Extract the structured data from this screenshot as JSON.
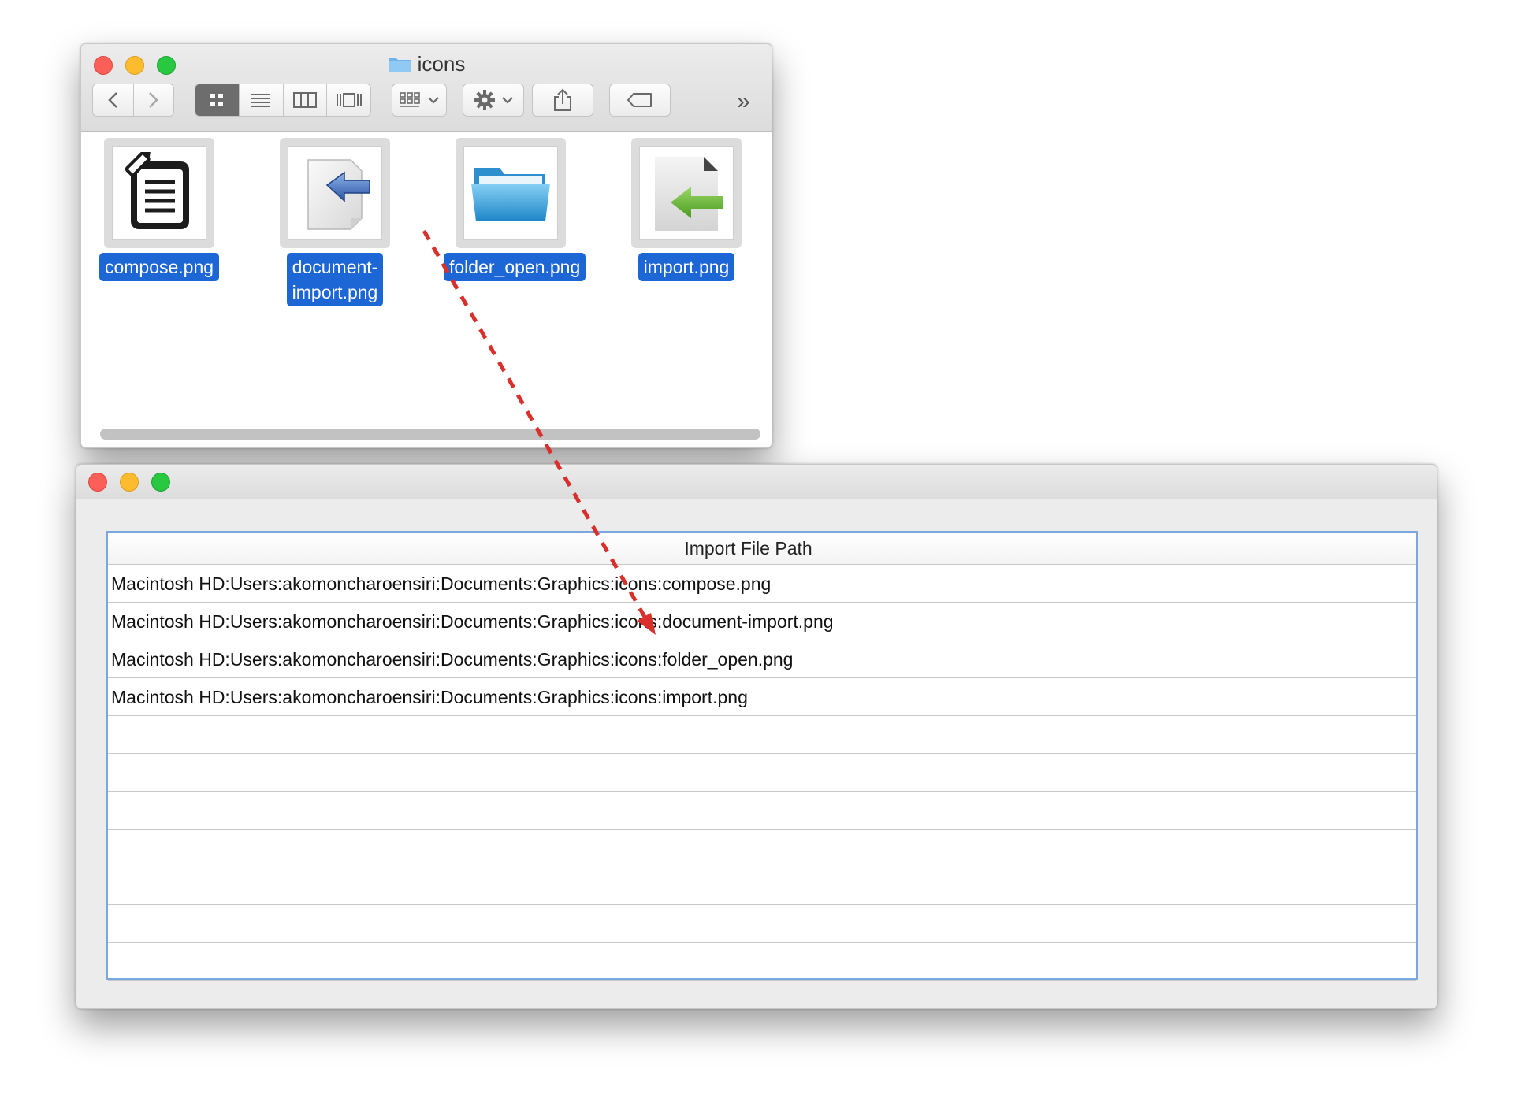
{
  "finder": {
    "title": "icons",
    "toolbar": {
      "back": "back",
      "forward": "forward",
      "overflow_glyph": "»"
    },
    "files": [
      {
        "label": "compose.png",
        "icon": "compose-icon"
      },
      {
        "label_line1": "document-",
        "label_line2": "import.png",
        "icon": "document-import-icon"
      },
      {
        "label": "folder_open.png",
        "icon": "folder-open-icon"
      },
      {
        "label": "import.png",
        "icon": "import-arrow-icon"
      }
    ]
  },
  "importer": {
    "table": {
      "header": "Import File Path",
      "rows": [
        "Macintosh HD:Users:akomoncharoensiri:Documents:Graphics:icons:compose.png",
        "Macintosh HD:Users:akomoncharoensiri:Documents:Graphics:icons:document-import.png",
        "Macintosh HD:Users:akomoncharoensiri:Documents:Graphics:icons:folder_open.png",
        "Macintosh HD:Users:akomoncharoensiri:Documents:Graphics:icons:import.png",
        "",
        "",
        "",
        "",
        "",
        "",
        ""
      ]
    }
  },
  "colors": {
    "selection": "#1d66d6",
    "drag_arrow": "#d9302c",
    "table_focus": "#7aa7de"
  }
}
